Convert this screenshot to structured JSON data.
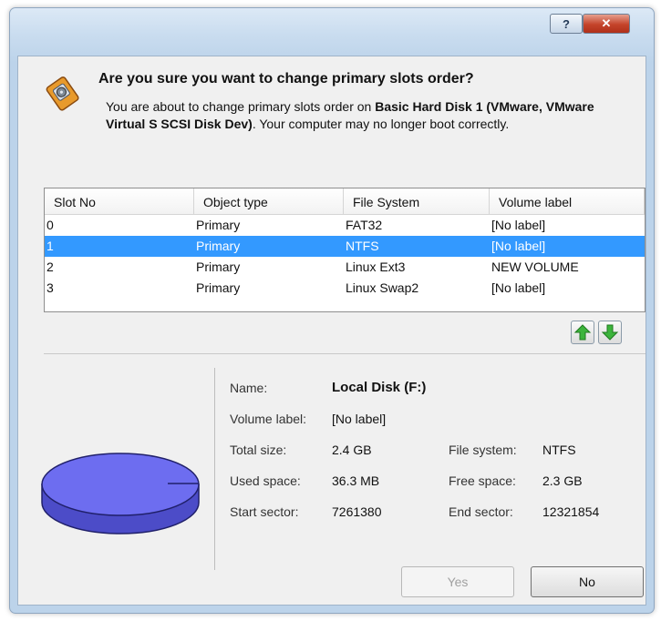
{
  "titlebar": {
    "help_label": "?",
    "close_label": "✕",
    "help_icon": "question-icon",
    "close_icon": "close-icon"
  },
  "header": {
    "icon": "partition-slot-icon",
    "heading": "Are you sure you want to change primary slots order?",
    "message_prefix": "You are about to change primary slots order on ",
    "message_bold": "Basic Hard Disk 1 (VMware, VMware Virtual S SCSI Disk Dev)",
    "message_suffix": ". Your computer may no longer boot correctly."
  },
  "table": {
    "columns": [
      "Slot No",
      "Object type",
      "File System",
      "Volume label"
    ],
    "rows": [
      [
        "0",
        "Primary",
        "FAT32",
        "[No label]"
      ],
      [
        "1",
        "Primary",
        "NTFS",
        "[No label]"
      ],
      [
        "2",
        "Primary",
        "Linux Ext3",
        "NEW VOLUME"
      ],
      [
        "3",
        "Primary",
        "Linux Swap2",
        "[No label]"
      ]
    ],
    "selected_row": 1
  },
  "move_buttons": {
    "up_icon": "arrow-up-icon",
    "down_icon": "arrow-down-icon"
  },
  "details": {
    "disk_icon": "disk-icon",
    "name_label": "Name:",
    "name_value": "Local Disk (F:)",
    "volume_label_label": "Volume label:",
    "volume_label_value": "[No label]",
    "total_size_label": "Total size:",
    "total_size_value": "2.4 GB",
    "file_system_label": "File system:",
    "file_system_value": "NTFS",
    "used_space_label": "Used space:",
    "used_space_value": "36.3 MB",
    "free_space_label": "Free space:",
    "free_space_value": "2.3 GB",
    "start_sector_label": "Start sector:",
    "start_sector_value": "7261380",
    "end_sector_label": "End sector:",
    "end_sector_value": "12321854"
  },
  "buttons": {
    "yes_label": "Yes",
    "no_label": "No"
  },
  "colors": {
    "selection": "#3399ff",
    "disk_fill": "#6d6df0",
    "arrow_green": "#2e9e2e"
  }
}
